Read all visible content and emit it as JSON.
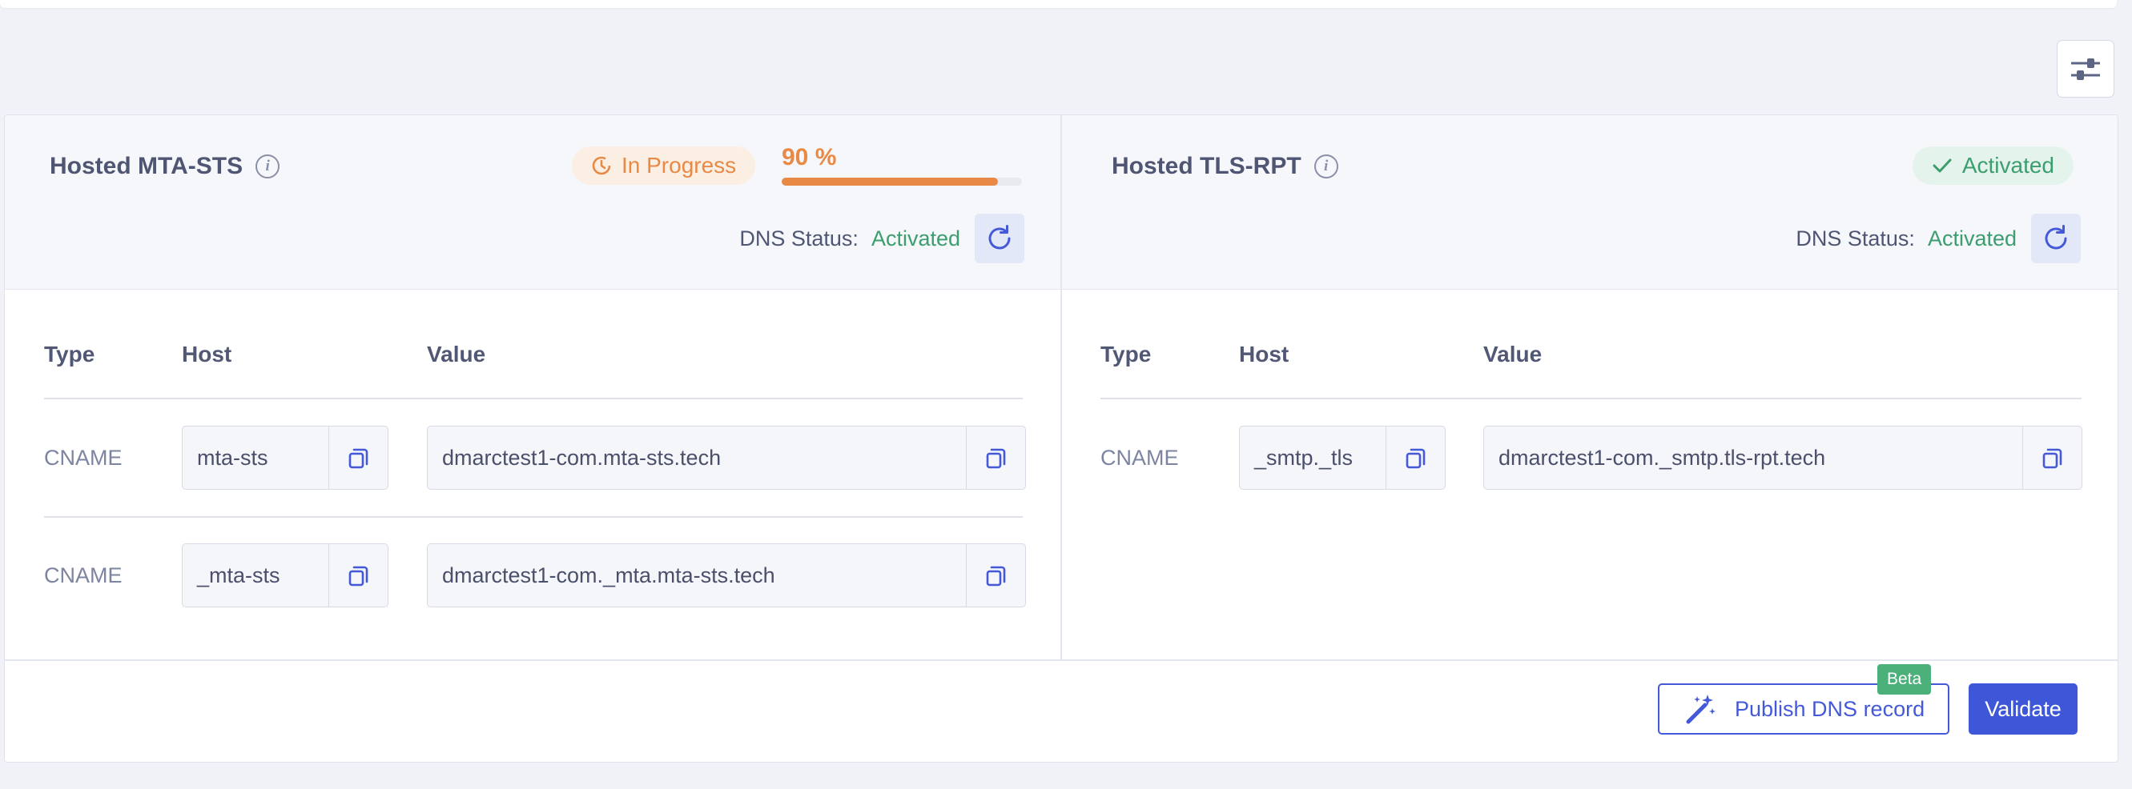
{
  "mta_sts": {
    "title": "Hosted MTA-STS",
    "status_badge": "In Progress",
    "progress_label": "90 %",
    "progress_value": 0.9,
    "dns_status_label": "DNS Status:",
    "dns_status_value": "Activated",
    "columns": [
      "Type",
      "Host",
      "Value"
    ],
    "rows": [
      {
        "type": "CNAME",
        "host": "mta-sts",
        "value": "dmarctest1-com.mta-sts.tech"
      },
      {
        "type": "CNAME",
        "host": "_mta-sts",
        "value": "dmarctest1-com._mta.mta-sts.tech"
      }
    ]
  },
  "tls_rpt": {
    "title": "Hosted TLS-RPT",
    "status_badge": "Activated",
    "dns_status_label": "DNS Status:",
    "dns_status_value": "Activated",
    "columns": [
      "Type",
      "Host",
      "Value"
    ],
    "rows": [
      {
        "type": "CNAME",
        "host": "_smtp._tls",
        "value": "dmarctest1-com._smtp.tls-rpt.tech"
      }
    ]
  },
  "actions": {
    "publish_label": "Publish DNS record",
    "beta_label": "Beta",
    "validate_label": "Validate"
  },
  "icons": {
    "filter": "sliders-icon",
    "info": "info-icon",
    "progress": "clock-history-icon",
    "activated": "check-icon",
    "refresh": "refresh-icon",
    "copy": "copy-icon",
    "publish": "magic-wand-icon"
  },
  "colors": {
    "accent": "#4459d8",
    "in_progress": "#e88a45",
    "activated": "#3c9e6e",
    "beta": "#4cb07b"
  }
}
